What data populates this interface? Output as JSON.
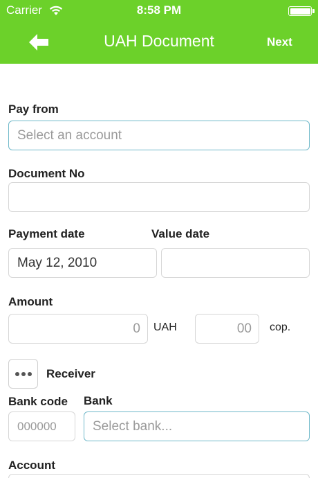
{
  "status_bar": {
    "carrier": "Carrier",
    "time": "8:58 PM"
  },
  "nav": {
    "title": "UAH Document",
    "next_label": "Next",
    "back_icon": "arrow-left-icon"
  },
  "form": {
    "pay_from": {
      "label": "Pay from",
      "placeholder": "Select an account"
    },
    "document_no": {
      "label": "Document No",
      "value": ""
    },
    "payment_date": {
      "label": "Payment date",
      "value": "May 12, 2010"
    },
    "value_date": {
      "label": "Value date",
      "value": ""
    },
    "amount": {
      "label": "Amount",
      "placeholder": "0",
      "currency": "UAH",
      "cents_placeholder": "00",
      "cents_unit": "cop."
    },
    "receiver": {
      "label": "Receiver",
      "icon": "more-dots-icon"
    },
    "bank_code": {
      "label": "Bank code",
      "placeholder": "000000"
    },
    "bank": {
      "label": "Bank",
      "placeholder": "Select bank..."
    },
    "account": {
      "label": "Account"
    }
  },
  "colors": {
    "header": "#6cd12a",
    "active_border": "#6fb8c9",
    "border": "#d6d6d6"
  }
}
